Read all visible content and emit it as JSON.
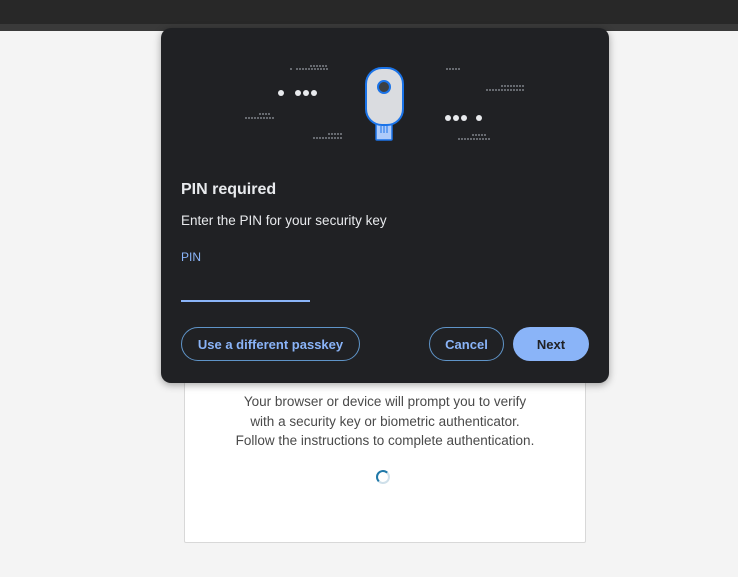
{
  "dialog": {
    "title": "PIN required",
    "description": "Enter the PIN for your security key",
    "pin_label": "PIN",
    "pin_value": "",
    "buttons": {
      "alternate": "Use a different passkey",
      "cancel": "Cancel",
      "next": "Next"
    },
    "illustration_icon": "security-key-icon"
  },
  "page": {
    "instructions": [
      "Your browser or device will prompt you to verify",
      "with a security key or biometric authenticator.",
      "Follow the instructions to complete authentication."
    ],
    "spinner_icon": "loading-spinner-icon"
  },
  "colors": {
    "dialog_bg": "#202124",
    "accent": "#8ab4f8",
    "topbar": "#282828"
  }
}
